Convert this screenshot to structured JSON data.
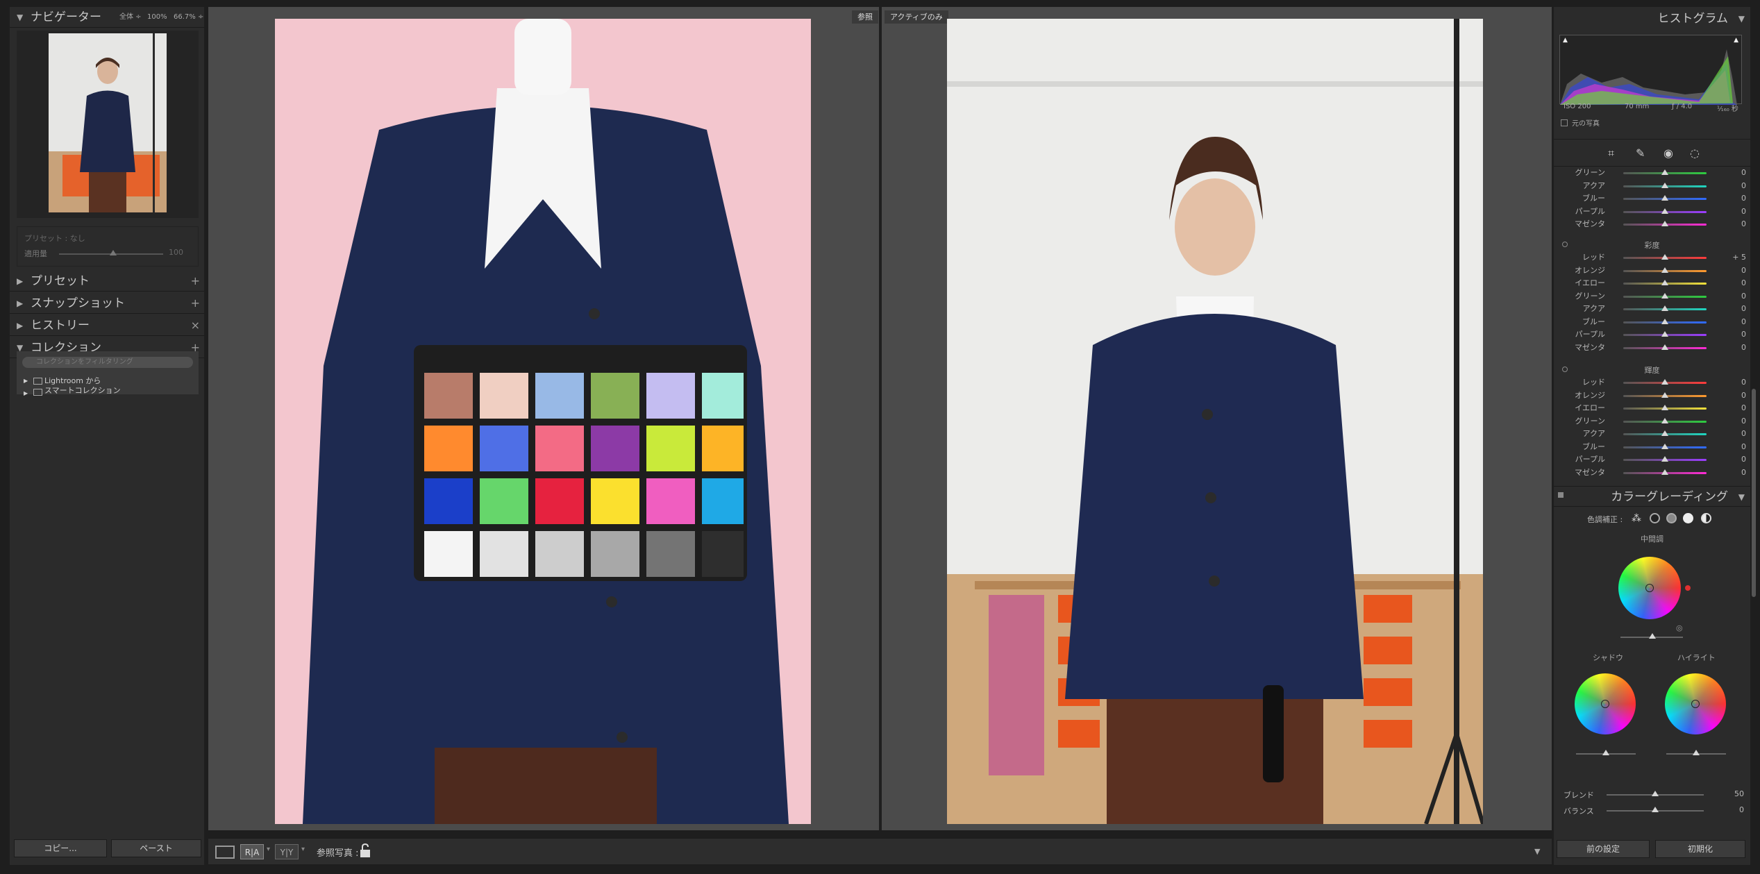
{
  "left_panel": {
    "navigator": {
      "title": "ナビゲーター",
      "zoom_fit": "全体 ÷",
      "zoom_100": "100%",
      "zoom_other": "66.7% ÷"
    },
    "preset_area": {
      "preset_label": "プリセット : なし",
      "amount_label": "適用量",
      "amount_value": "100"
    },
    "presets": {
      "title": "プリセット",
      "icon": "plus-icon"
    },
    "snapshots": {
      "title": "スナップショット",
      "icon": "plus-icon"
    },
    "history": {
      "title": "ヒストリー",
      "icon": "close-icon"
    },
    "collections": {
      "title": "コレクション",
      "filter_placeholder": "コレクションをフィルタリング",
      "items": [
        {
          "label": "Lightroom から"
        },
        {
          "label": "スマートコレクション"
        }
      ]
    },
    "copy_button": "コピー...",
    "paste_button": "ペースト"
  },
  "center": {
    "reference_tag": "参照",
    "active_tag": "アクティブのみ"
  },
  "toolbar": {
    "ref_photo_label": "参照写真 :",
    "ra_label": "R|A",
    "yy_label": "Y|Y"
  },
  "right_panel": {
    "histogram": {
      "title": "ヒストグラム",
      "iso": "ISO 200",
      "focal": "70 mm",
      "aperture": "ƒ / 4.0",
      "shutter": "¹⁄₁₆₀ 秒",
      "original_label": "元の写真"
    },
    "hsl": {
      "hue_tail": [
        {
          "label": "グリーン",
          "value": "0",
          "color": "#2ecc40"
        },
        {
          "label": "アクア",
          "value": "0",
          "color": "#1fd6c0"
        },
        {
          "label": "ブルー",
          "value": "0",
          "color": "#2f6bff"
        },
        {
          "label": "パープル",
          "value": "0",
          "color": "#9b3dff"
        },
        {
          "label": "マゼンタ",
          "value": "0",
          "color": "#ff2bd6"
        }
      ],
      "saturation_title": "彩度",
      "saturation": [
        {
          "label": "レッド",
          "value": "+ 5",
          "color": "#ff3b3b"
        },
        {
          "label": "オレンジ",
          "value": "0",
          "color": "#ff9a2e"
        },
        {
          "label": "イエロー",
          "value": "0",
          "color": "#f3e23a"
        },
        {
          "label": "グリーン",
          "value": "0",
          "color": "#2ecc40"
        },
        {
          "label": "アクア",
          "value": "0",
          "color": "#1fd6c0"
        },
        {
          "label": "ブルー",
          "value": "0",
          "color": "#2f6bff"
        },
        {
          "label": "パープル",
          "value": "0",
          "color": "#9b3dff"
        },
        {
          "label": "マゼンタ",
          "value": "0",
          "color": "#ff2bd6"
        }
      ],
      "luminance_title": "輝度",
      "luminance": [
        {
          "label": "レッド",
          "value": "0",
          "color": "#ff3b3b"
        },
        {
          "label": "オレンジ",
          "value": "0",
          "color": "#ff9a2e"
        },
        {
          "label": "イエロー",
          "value": "0",
          "color": "#f3e23a"
        },
        {
          "label": "グリーン",
          "value": "0",
          "color": "#2ecc40"
        },
        {
          "label": "アクア",
          "value": "0",
          "color": "#1fd6c0"
        },
        {
          "label": "ブルー",
          "value": "0",
          "color": "#2f6bff"
        },
        {
          "label": "パープル",
          "value": "0",
          "color": "#9b3dff"
        },
        {
          "label": "マゼンタ",
          "value": "0",
          "color": "#ff2bd6"
        }
      ]
    },
    "color_grading": {
      "title": "カラーグレーディング",
      "adjust_label": "色調補正 :",
      "midtones_label": "中間調",
      "shadows_label": "シャドウ",
      "highlights_label": "ハイライト",
      "blend_label": "ブレンド",
      "blend_value": "50",
      "balance_label": "バランス",
      "balance_value": "0"
    },
    "prev_button": "前の設定",
    "reset_button": "初期化"
  }
}
